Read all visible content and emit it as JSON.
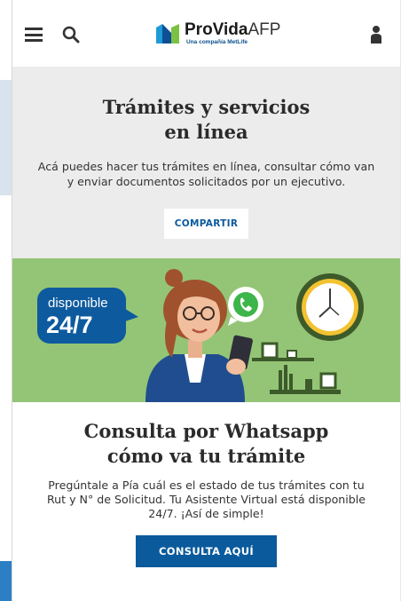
{
  "header": {
    "logo_text": "ProVida",
    "logo_suffix": "AFP",
    "logo_tagline": "Una compañía MetLife"
  },
  "services": {
    "title_line1": "Trámites y servicios",
    "title_line2": "en línea",
    "description": "Acá puedes hacer tus trámites en línea, consultar cómo van y enviar documentos solicitados por un ejecutivo.",
    "share_label": "COMPARTIR"
  },
  "banner": {
    "badge_line1": "disponible",
    "badge_line2": "24/7"
  },
  "whatsapp": {
    "title_line1": "Consulta por Whatsapp",
    "title_line2": "cómo va tu trámite",
    "description": "Pregúntale a Pía cuál es el estado de tus trámites con tu Rut y N° de Solicitud. Tu Asistente Virtual está disponible 24/7. ¡Así de simple!",
    "cta_label": "CONSULTA AQUÍ"
  },
  "colors": {
    "brand_blue": "#0a5a9c",
    "banner_green": "#94c576",
    "section_gray": "#ececec"
  }
}
